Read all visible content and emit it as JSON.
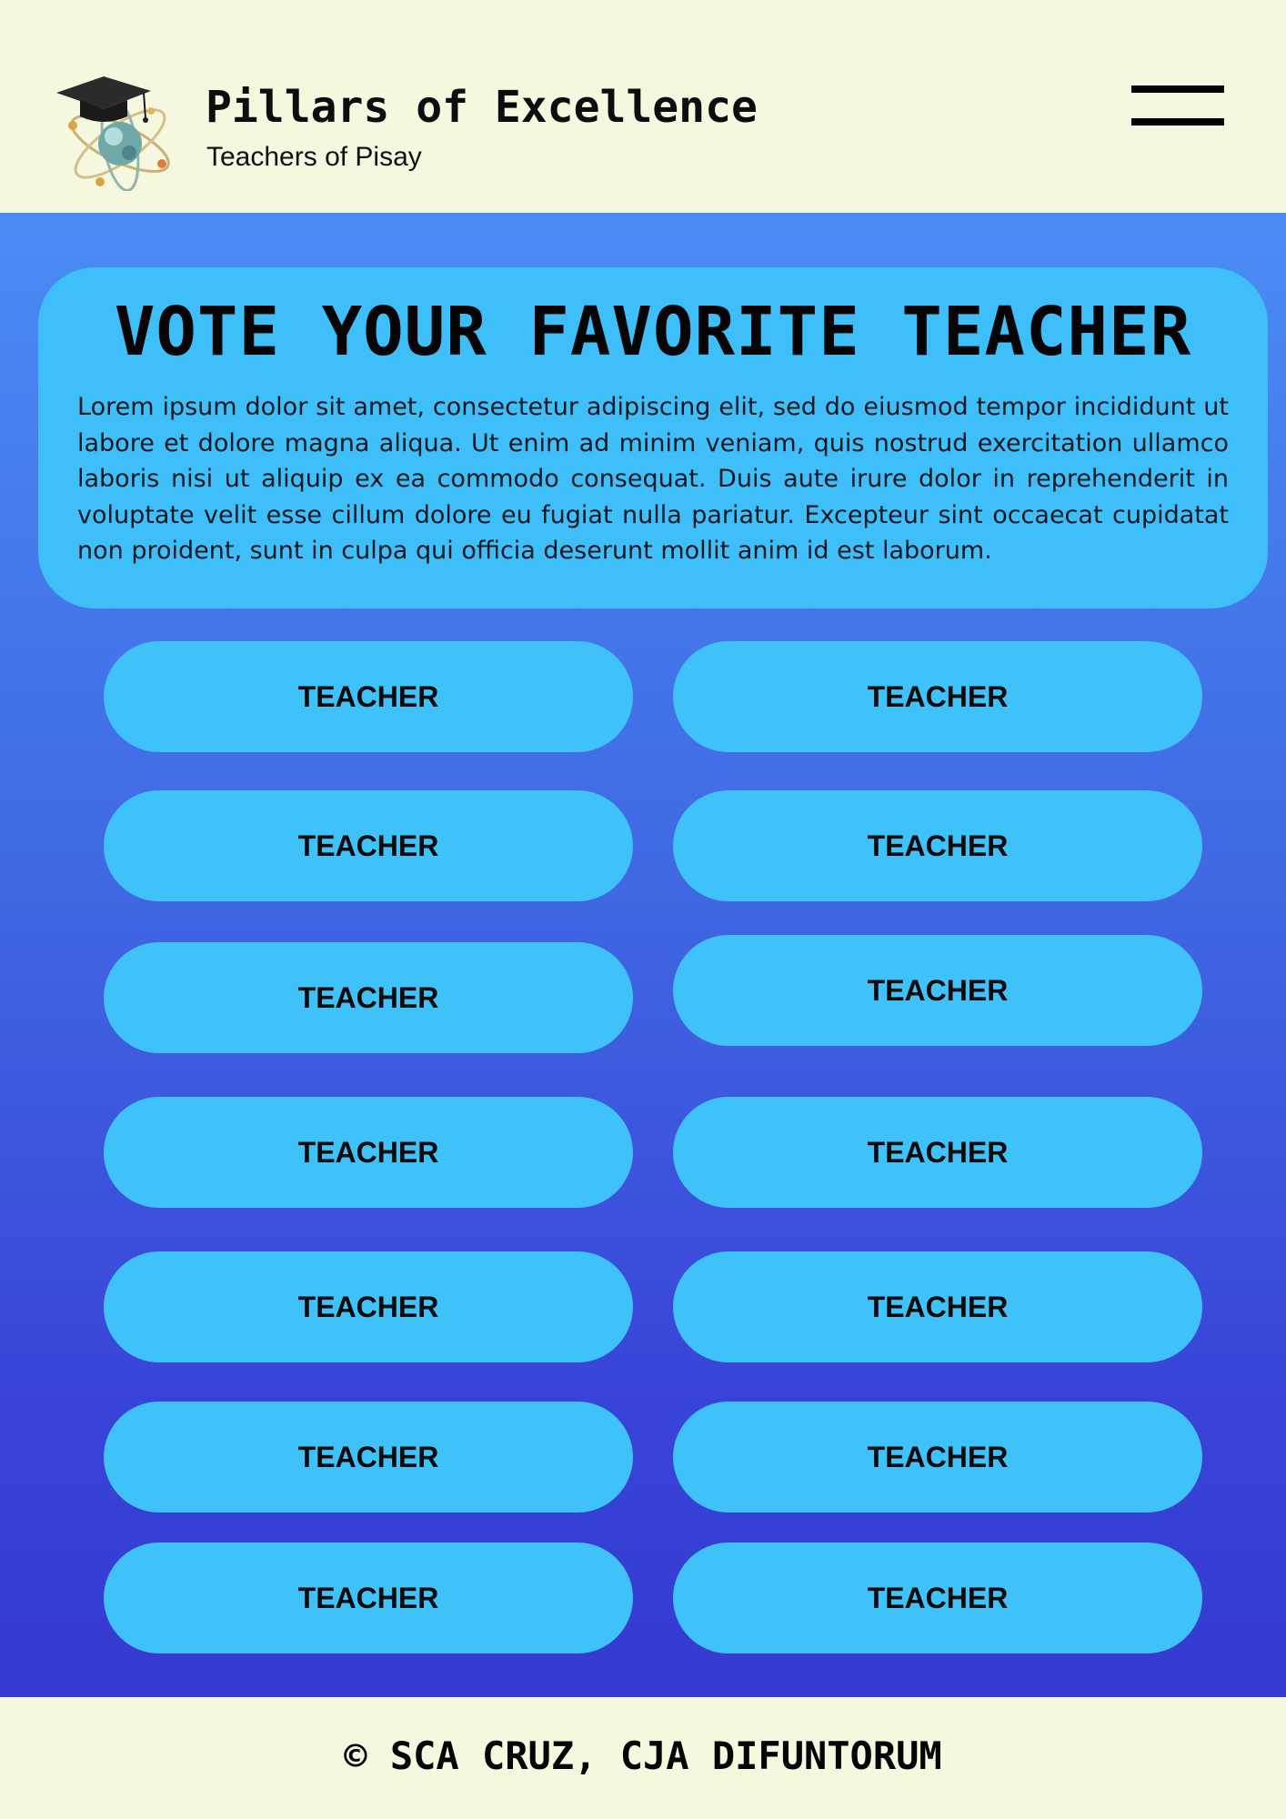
{
  "header": {
    "title": "Pillars of Excellence",
    "subtitle": "Teachers of Pisay",
    "logo_icon": "graduation-cap-atom-icon",
    "menu_icon": "hamburger-menu-icon"
  },
  "intro": {
    "heading": "VOTE YOUR FAVORITE TEACHER",
    "body": "Lorem ipsum dolor sit amet, consectetur adipiscing elit, sed do eiusmod tempor incididunt ut labore et dolore magna aliqua. Ut enim ad minim veniam, quis nostrud exercitation ullamco laboris nisi ut aliquip ex ea commodo consequat. Duis aute irure dolor in reprehenderit in voluptate velit esse cillum dolore eu fugiat nulla pariatur. Excepteur sint occaecat cupidatat non proident, sunt in culpa qui officia deserunt mollit anim id est laborum."
  },
  "teachers": [
    {
      "label": "TEACHER"
    },
    {
      "label": "TEACHER"
    },
    {
      "label": "TEACHER"
    },
    {
      "label": "TEACHER"
    },
    {
      "label": "TEACHER"
    },
    {
      "label": "TEACHER"
    },
    {
      "label": "TEACHER"
    },
    {
      "label": "TEACHER"
    },
    {
      "label": "TEACHER"
    },
    {
      "label": "TEACHER"
    },
    {
      "label": "TEACHER"
    },
    {
      "label": "TEACHER"
    },
    {
      "label": "TEACHER"
    },
    {
      "label": "TEACHER"
    }
  ],
  "footer": {
    "credit": "© SCA CRUZ, CJA DIFUNTORUM"
  },
  "colors": {
    "background": "#f5f7df",
    "card": "#3fbff9",
    "gradient_top": "#4a8cf4",
    "gradient_bottom": "#353ad0"
  }
}
